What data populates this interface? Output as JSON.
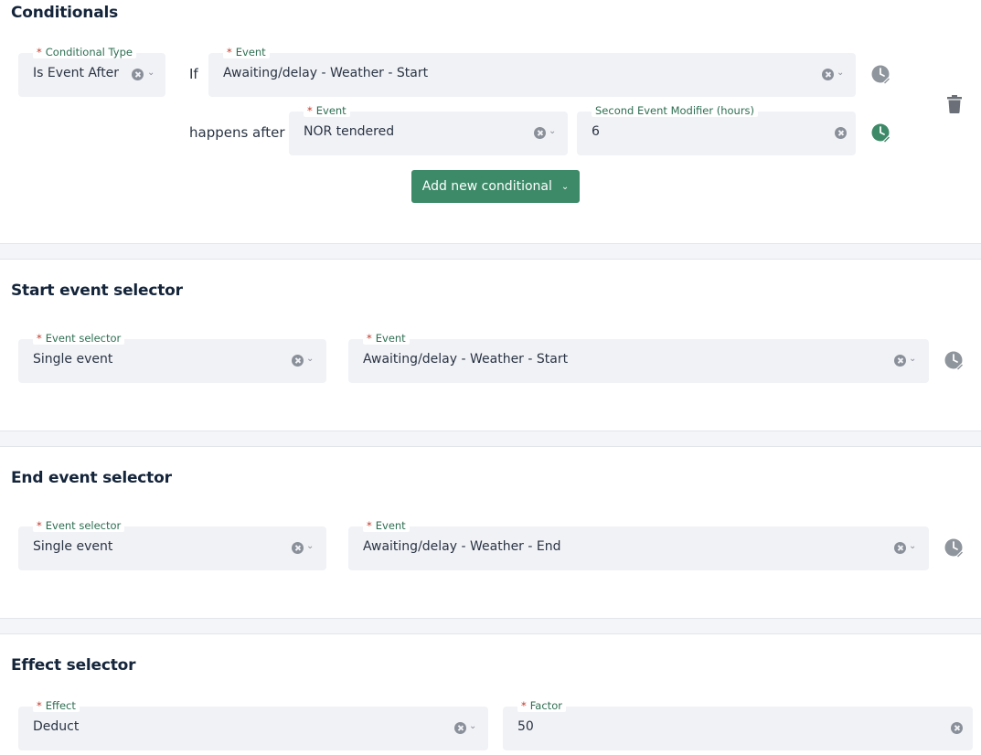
{
  "sections": {
    "conditionals": {
      "title": "Conditionals"
    },
    "start": {
      "title": "Start event selector"
    },
    "end": {
      "title": "End event selector"
    },
    "effect": {
      "title": "Effect selector"
    }
  },
  "conditional": {
    "type_label": "Conditional Type",
    "type_value": "Is Event After",
    "if_text": "If",
    "event1_label": "Event",
    "event1_value": "Awaiting/delay - Weather - Start",
    "happens_after_text": "happens after",
    "event2_label": "Event",
    "event2_value": "NOR tendered",
    "modifier_label": "Second Event Modifier (hours)",
    "modifier_value": "6",
    "add_button_label": "Add new conditional"
  },
  "start_selector": {
    "selector_label": "Event selector",
    "selector_value": "Single event",
    "event_label": "Event",
    "event_value": "Awaiting/delay - Weather - Start"
  },
  "end_selector": {
    "selector_label": "Event selector",
    "selector_value": "Single event",
    "event_label": "Event",
    "event_value": "Awaiting/delay - Weather - End"
  },
  "effect_selector": {
    "effect_label": "Effect",
    "effect_value": "Deduct",
    "factor_label": "Factor",
    "factor_value": "50"
  },
  "required_marker": "*",
  "colors": {
    "accent": "#3d8a68",
    "label": "#2e6e52",
    "required": "#c0392b",
    "field_bg": "#f1f2f6",
    "icon_grey": "#8f959c"
  },
  "icons": [
    "clock-edit-icon",
    "trash-icon",
    "clear-icon",
    "chevron-down-icon"
  ]
}
